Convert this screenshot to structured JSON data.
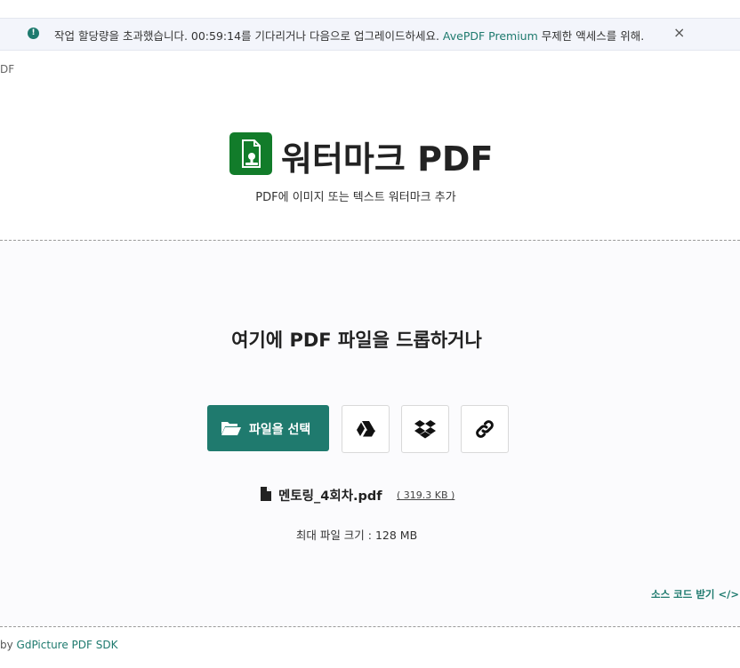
{
  "notice": {
    "text": "작업 할당량을 초과했습니다. 00:59:14를 기다리거나 다음으로 업그레이드하세요.",
    "link": "AvePDF Premium",
    "text_after": "무제한 액세스를 위해.",
    "close": "×"
  },
  "breadcrumb": "DF",
  "header": {
    "title": "워터마크 PDF",
    "subtitle": "PDF에 이미지 또는 텍스트 워터마크 추가"
  },
  "dropzone": {
    "heading_part1": "여기에 ",
    "heading_bold": "PDF",
    "heading_part2": " 파일을 드롭하거나",
    "choose_label": "파일을 선택",
    "sources": [
      "google-drive-icon",
      "dropbox-icon",
      "link-icon"
    ],
    "file": {
      "name": "멘토링_4회차.pdf",
      "size": "( 319.3 KB )"
    },
    "max_size": "최대 파일 크기 : 128 MB",
    "source_code": "소스 코드 받기 </>"
  },
  "footer": {
    "prefix": "by ",
    "link": "GdPicture PDF SDK"
  },
  "colors": {
    "accent": "#1f7a6e",
    "brand_icon": "#127c2a"
  }
}
